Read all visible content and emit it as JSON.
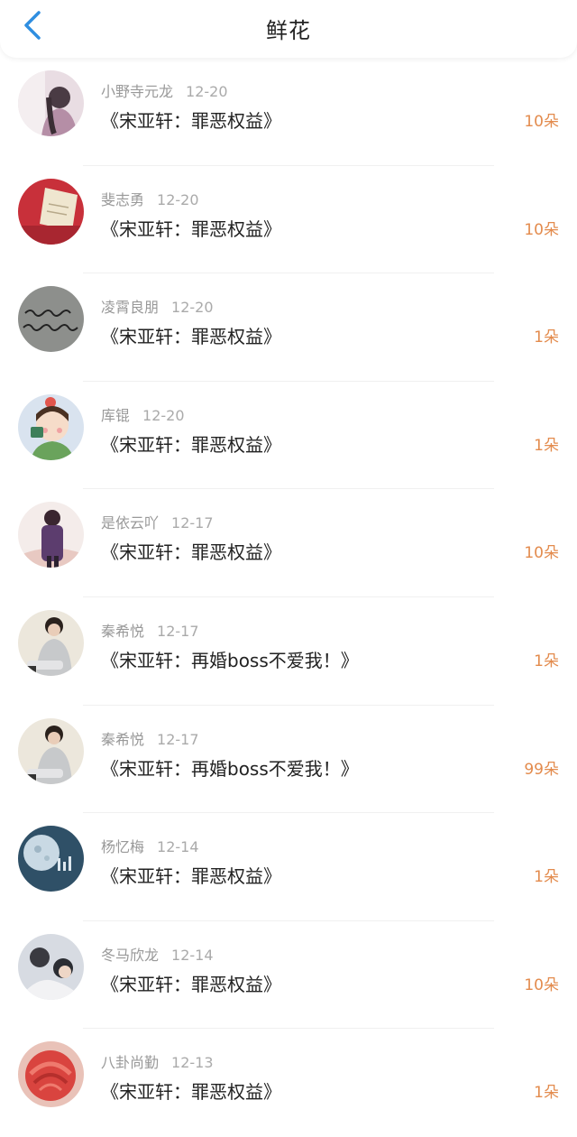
{
  "header": {
    "title": "鲜花"
  },
  "items": [
    {
      "user": "小野寺元龙",
      "date": "12-20",
      "book": "《宋亚轩：罪恶权益》",
      "count": "10朵",
      "avatar": "avatar-girl-purple"
    },
    {
      "user": "斐志勇",
      "date": "12-20",
      "book": "《宋亚轩：罪恶权益》",
      "count": "10朵",
      "avatar": "avatar-red-notes"
    },
    {
      "user": "凌霄良朋",
      "date": "12-20",
      "book": "《宋亚轩：罪恶权益》",
      "count": "1朵",
      "avatar": "avatar-handwriting"
    },
    {
      "user": "库锟",
      "date": "12-20",
      "book": "《宋亚轩：罪恶权益》",
      "count": "1朵",
      "avatar": "avatar-cartoon-girl"
    },
    {
      "user": "是依云吖",
      "date": "12-17",
      "book": "《宋亚轩：罪恶权益》",
      "count": "10朵",
      "avatar": "avatar-person-purple"
    },
    {
      "user": "秦希悦",
      "date": "12-17",
      "book": "《宋亚轩：再婚boss不爱我！》",
      "count": "1朵",
      "avatar": "avatar-boy-sweater"
    },
    {
      "user": "秦希悦",
      "date": "12-17",
      "book": "《宋亚轩：再婚boss不爱我！》",
      "count": "99朵",
      "avatar": "avatar-boy-sweater"
    },
    {
      "user": "杨忆梅",
      "date": "12-14",
      "book": "《宋亚轩：罪恶权益》",
      "count": "1朵",
      "avatar": "avatar-moon-blue"
    },
    {
      "user": "冬马欣龙",
      "date": "12-14",
      "book": "《宋亚轩：罪恶权益》",
      "count": "10朵",
      "avatar": "avatar-couple"
    },
    {
      "user": "八卦尚勤",
      "date": "12-13",
      "book": "《宋亚轩：罪恶权益》",
      "count": "1朵",
      "avatar": "avatar-rose"
    }
  ]
}
